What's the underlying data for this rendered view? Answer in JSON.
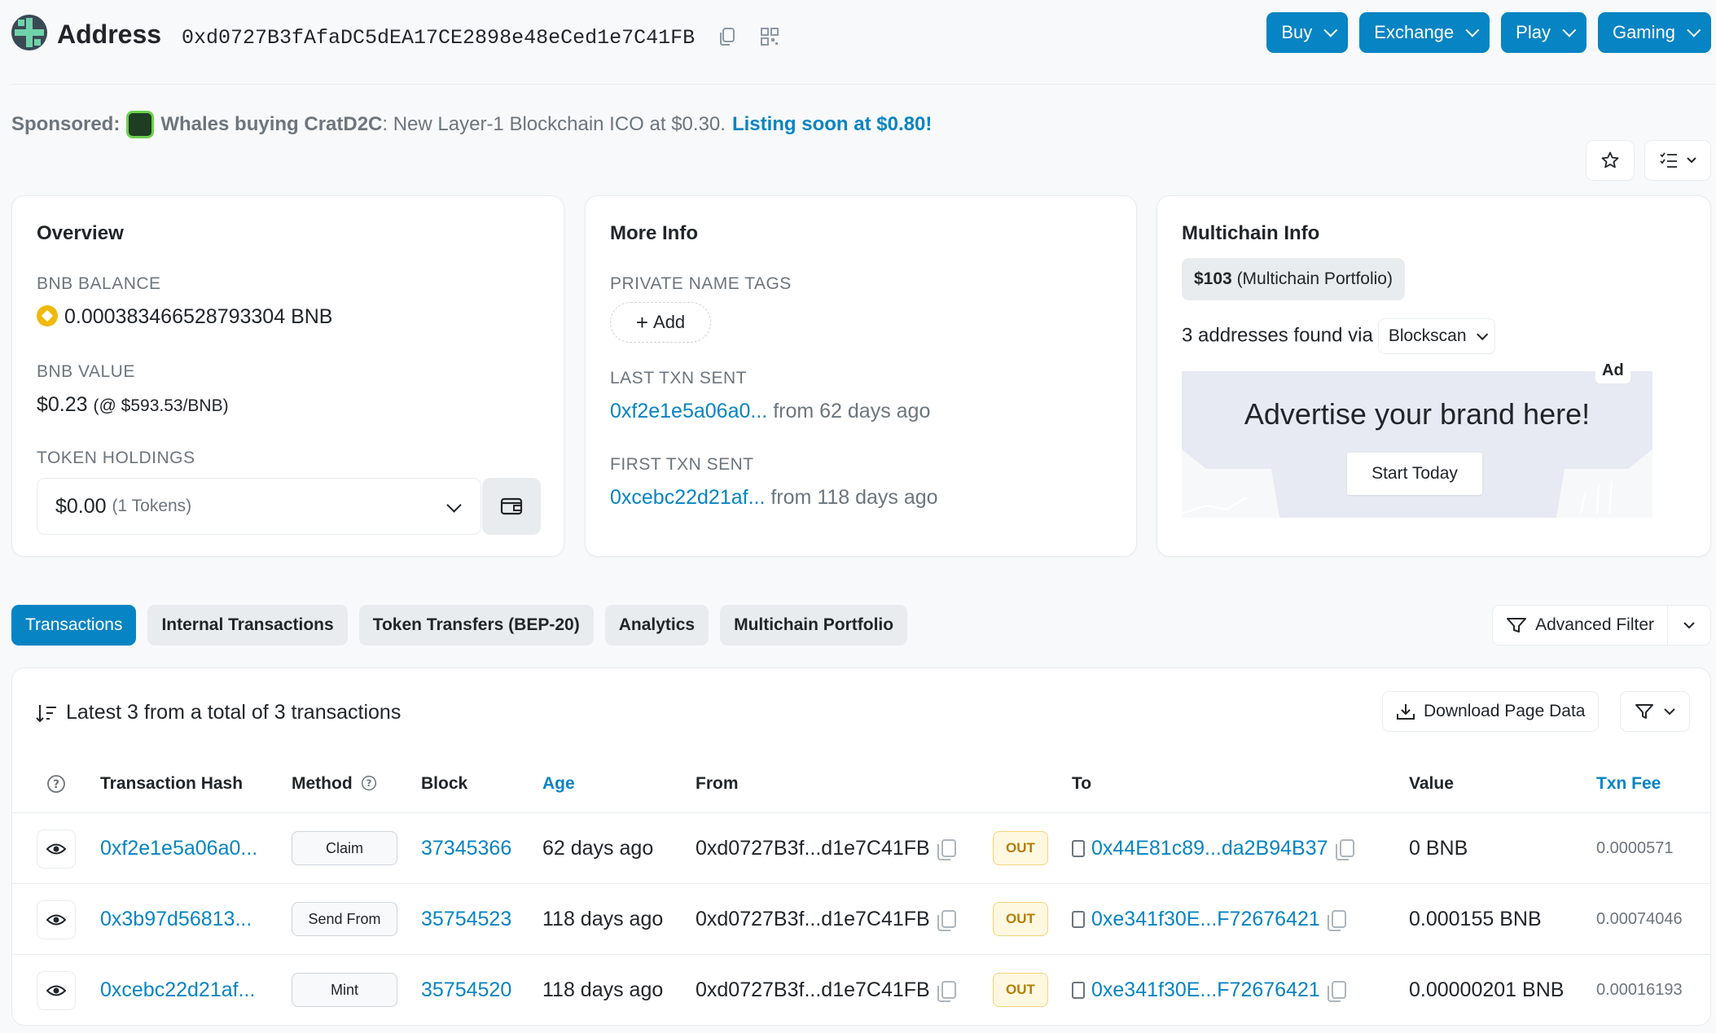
{
  "header": {
    "title": "Address",
    "address": "0xd0727B3fAfaDC5dEA17CE2898e48eCed1e7C41FB",
    "nav": [
      {
        "label": "Buy"
      },
      {
        "label": "Exchange"
      },
      {
        "label": "Play"
      },
      {
        "label": "Gaming"
      }
    ]
  },
  "sponsored": {
    "label": "Sponsored:",
    "bold_text": "Whales buying CratD2C",
    "text": ": New Layer-1 Blockchain ICO at $0.30.",
    "link_text": "Listing soon at $0.80!"
  },
  "overview": {
    "title": "Overview",
    "bnb_balance_label": "BNB BALANCE",
    "bnb_balance": "0.000383466528793304 BNB",
    "bnb_value_label": "BNB VALUE",
    "bnb_value": "$0.23",
    "bnb_price": "(@ $593.53/BNB)",
    "token_holdings_label": "TOKEN HOLDINGS",
    "token_value": "$0.00",
    "token_count": "(1 Tokens)"
  },
  "more_info": {
    "title": "More Info",
    "private_tags_label": "PRIVATE NAME TAGS",
    "add_label": "Add",
    "last_txn_label": "LAST TXN SENT",
    "last_txn_hash": "0xf2e1e5a06a0...",
    "last_txn_age": "from 62 days ago",
    "first_txn_label": "FIRST TXN SENT",
    "first_txn_hash": "0xcebc22d21af...",
    "first_txn_age": "from 118 days ago"
  },
  "multichain": {
    "title": "Multichain Info",
    "portfolio_value": "$103",
    "portfolio_label": "(Multichain Portfolio)",
    "addresses_found": "3 addresses found via",
    "blockscan_label": "Blockscan",
    "ad_badge": "Ad",
    "ad_text": "Advertise your brand here!",
    "ad_button": "Start Today"
  },
  "tabs": [
    {
      "label": "Transactions",
      "active": true
    },
    {
      "label": "Internal Transactions"
    },
    {
      "label": "Token Transfers (BEP-20)"
    },
    {
      "label": "Analytics"
    },
    {
      "label": "Multichain Portfolio"
    }
  ],
  "advanced_filter_label": "Advanced Filter",
  "table": {
    "summary": "Latest 3 from a total of 3 transactions",
    "download_label": "Download Page Data",
    "columns": [
      "Transaction Hash",
      "Method",
      "Block",
      "Age",
      "From",
      "To",
      "Value",
      "Txn Fee"
    ],
    "rows": [
      {
        "hash": "0xf2e1e5a06a0...",
        "method": "Claim",
        "block": "37345366",
        "age": "62 days ago",
        "from": "0xd0727B3f...d1e7C41FB",
        "dir": "OUT",
        "to": "0x44E81c89...da2B94B37",
        "value": "0 BNB",
        "fee": "0.0000571"
      },
      {
        "hash": "0x3b97d56813...",
        "method": "Send From",
        "block": "35754523",
        "age": "118 days ago",
        "from": "0xd0727B3f...d1e7C41FB",
        "dir": "OUT",
        "to": "0xe341f30E...F72676421",
        "value": "0.000155 BNB",
        "fee": "0.00074046"
      },
      {
        "hash": "0xcebc22d21af...",
        "method": "Mint",
        "block": "35754520",
        "age": "118 days ago",
        "from": "0xd0727B3f...d1e7C41FB",
        "dir": "OUT",
        "to": "0xe341f30E...F72676421",
        "value": "0.00000201 BNB",
        "fee": "0.00016193"
      }
    ]
  },
  "colors": {
    "accent": "#0784c3",
    "out_badge": "#f3d37a",
    "bnb": "#f0b90b"
  }
}
